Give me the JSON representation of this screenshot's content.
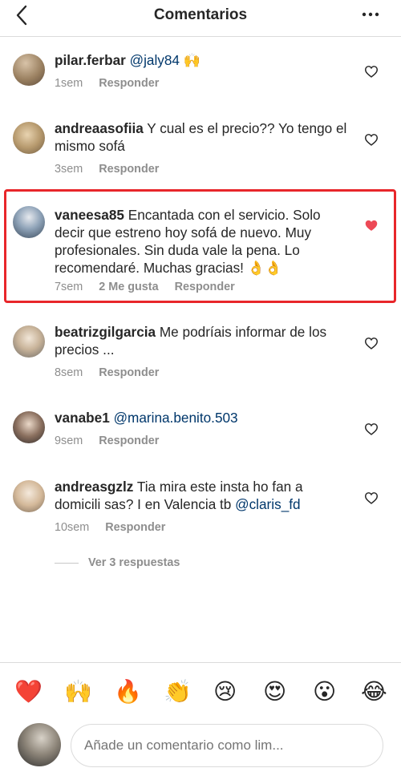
{
  "header": {
    "title": "Comentarios"
  },
  "comments": [
    {
      "user": "pilar.ferbar",
      "text": " ",
      "mention": "@jaly84",
      "emoji": " 🙌",
      "time": "1sem",
      "likes": "",
      "reply": "Responder",
      "liked": false
    },
    {
      "user": "andreaasofiia",
      "text": " Y cual es el precio?? Yo tengo el mismo sofá",
      "time": "3sem",
      "likes": "",
      "reply": "Responder",
      "liked": false
    },
    {
      "user": "vaneesa85",
      "text": " Encantada con el servicio. Solo decir que estreno hoy sofá de nuevo. Muy profesionales. Sin duda vale la pena. Lo recomendaré. Muchas gracias! 👌👌",
      "time": "7sem",
      "likes": "2 Me gusta",
      "reply": "Responder",
      "liked": true
    },
    {
      "user": "beatrizgilgarcia",
      "text": " Me podríais informar de los precios ...",
      "time": "8sem",
      "likes": "",
      "reply": "Responder",
      "liked": false
    },
    {
      "user": "vanabe1",
      "text": " ",
      "mention": "@marina.benito.503",
      "time": "9sem",
      "likes": "",
      "reply": "Responder",
      "liked": false
    },
    {
      "user": "andreasgzlz",
      "text": " Tia mira este insta ho fan a domicili sas? I en Valencia tb ",
      "mention": "@claris_fd",
      "time": "10sem",
      "likes": "",
      "reply": "Responder",
      "liked": false
    }
  ],
  "replies": {
    "label": "Ver 3 respuestas"
  },
  "emoji_bar": [
    "❤️",
    "🙌",
    "🔥",
    "👏",
    "😢",
    "😍",
    "😮",
    "😂"
  ],
  "composer": {
    "placeholder": "Añade un comentario como lim..."
  },
  "colors": {
    "highlight": "#e8262a",
    "liked_heart": "#ed4956",
    "mention": "#00376b",
    "muted": "#8e8e8e"
  }
}
